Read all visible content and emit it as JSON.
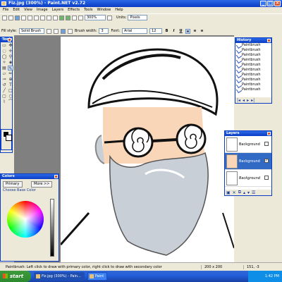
{
  "window": {
    "title": "Fiz.jpg (300%) - Paint.NET v2.72"
  },
  "menu": [
    "File",
    "Edit",
    "View",
    "Image",
    "Layers",
    "Effects",
    "Tools",
    "Window",
    "Help"
  ],
  "toolbar": {
    "zoom": "300%",
    "units_label": "Units:",
    "units_value": "Pixels"
  },
  "toolbar2": {
    "fill_label": "Fill style:",
    "fill_value": "Solid Brush",
    "brush_width_label": "Brush width:",
    "brush_width_value": "3",
    "font_label": "Font:",
    "font_value": "Arial",
    "font_size": "12",
    "bold": "B",
    "italic": "I",
    "underline": "U"
  },
  "tools_panel": {
    "title": "Tools",
    "items": [
      "select-rect",
      "move",
      "lasso",
      "zoom",
      "magic-wand",
      "paint-bucket",
      "paintbrush",
      "pencil",
      "clone",
      "eraser",
      "text",
      "color-picker",
      "line",
      "rectangle",
      "ellipse",
      "freeform"
    ]
  },
  "history": {
    "title": "History",
    "items": [
      "Paintbrush",
      "Paintbrush",
      "Paintbrush",
      "Paintbrush",
      "Paintbrush",
      "Paintbrush",
      "Paintbrush",
      "Paintbrush",
      "Paintbrush",
      "Paintbrush"
    ]
  },
  "layers": {
    "title": "Layers",
    "items": [
      {
        "name": "Background",
        "visible": false
      },
      {
        "name": "Background",
        "visible": true
      },
      {
        "name": "Background",
        "visible": false
      }
    ]
  },
  "colors": {
    "title": "Colors",
    "mode": "Primary",
    "more_label": "More >>",
    "base_label": "Choose Base Color"
  },
  "status": {
    "message": "Paintbrush: Left click to draw with primary color, right click to draw with secondary color",
    "size": "200 x 200",
    "coords": "151, -3"
  },
  "taskbar": {
    "start": "start",
    "tasks": [
      "Fiz.jpg (300%) - Pain...",
      "Paint"
    ],
    "clock": "1:42 PM"
  },
  "accent": "#0a3cc4",
  "skin_color": "#f9d6b8",
  "beard_color": "#c8cfd6"
}
